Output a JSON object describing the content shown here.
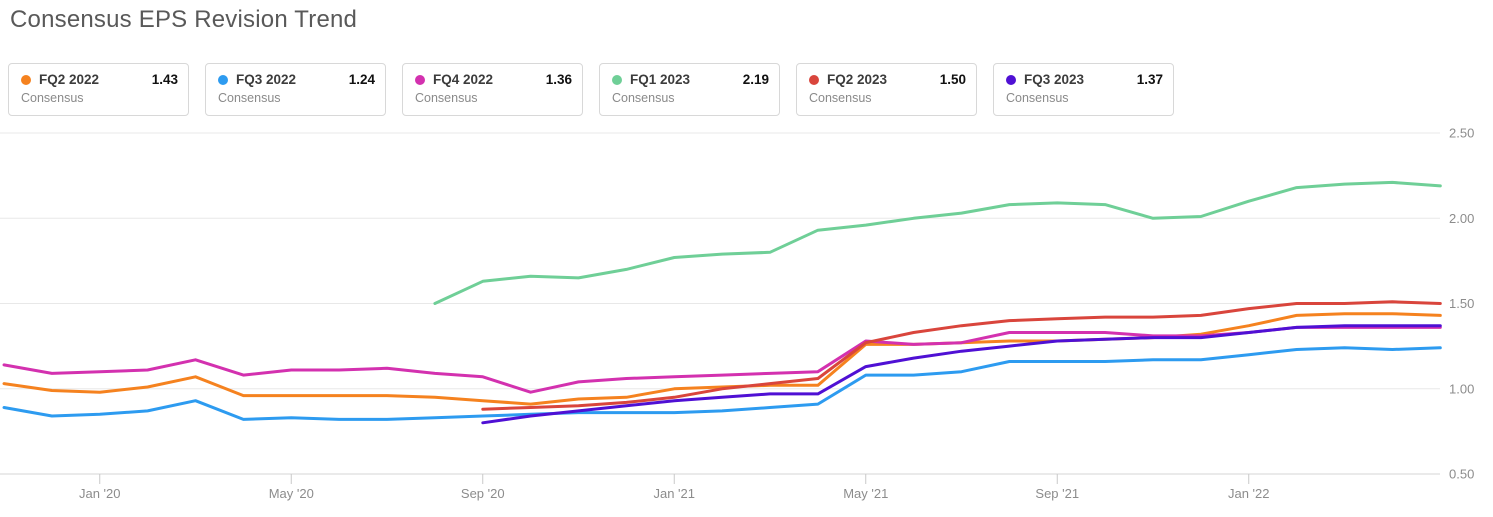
{
  "title": "Consensus EPS Revision Trend",
  "legend": {
    "sub_label": "Consensus",
    "items": [
      {
        "label": "FQ2 2022",
        "value": "1.43",
        "color": "#f5821f"
      },
      {
        "label": "FQ3 2022",
        "value": "1.24",
        "color": "#2d9bf0"
      },
      {
        "label": "FQ4 2022",
        "value": "1.36",
        "color": "#d331af"
      },
      {
        "label": "FQ1 2023",
        "value": "2.19",
        "color": "#6fcf97"
      },
      {
        "label": "FQ2 2023",
        "value": "1.50",
        "color": "#d9453c"
      },
      {
        "label": "FQ3 2023",
        "value": "1.37",
        "color": "#4f10d4"
      }
    ]
  },
  "colors": {
    "title_text": "#595959",
    "grid_line": "#e8e8e8",
    "axis_line": "#d4d4d4",
    "tick_mark": "#c9c9c9",
    "axis_text": "#8c8c8c",
    "background": "#ffffff"
  },
  "chart_data": {
    "type": "line",
    "title": "Consensus EPS Revision Trend",
    "xlabel": "",
    "ylabel": "",
    "ylim": [
      0.5,
      2.5
    ],
    "grid": true,
    "legend_position": "top",
    "x_categories": [
      "Nov '19",
      "Dec '19",
      "Jan '20",
      "Feb '20",
      "Mar '20",
      "Apr '20",
      "May '20",
      "Jun '20",
      "Jul '20",
      "Aug '20",
      "Sep '20",
      "Oct '20",
      "Nov '20",
      "Dec '20",
      "Jan '21",
      "Feb '21",
      "Mar '21",
      "Apr '21",
      "May '21",
      "Jun '21",
      "Jul '21",
      "Aug '21",
      "Sep '21",
      "Oct '21",
      "Nov '21",
      "Dec '21",
      "Jan '22",
      "Feb '22",
      "Mar '22",
      "Apr '22",
      "May '22"
    ],
    "x_tick_labels": [
      "Jan '20",
      "May '20",
      "Sep '20",
      "Jan '21",
      "May '21",
      "Sep '21",
      "Jan '22"
    ],
    "x_tick_indices": [
      2,
      6,
      10,
      14,
      18,
      22,
      26
    ],
    "y_ticks": [
      {
        "label": "2.50",
        "value": 2.5
      },
      {
        "label": "2.00",
        "value": 2.0
      },
      {
        "label": "1.50",
        "value": 1.5
      },
      {
        "label": "1.00",
        "value": 1.0
      },
      {
        "label": "0.50",
        "value": 0.5
      }
    ],
    "series": [
      {
        "name": "FQ2 2022 Consensus",
        "color": "#f5821f",
        "start_index": 0,
        "end_value": 1.43,
        "values": [
          1.03,
          0.99,
          0.98,
          1.01,
          1.07,
          0.96,
          0.96,
          0.96,
          0.96,
          0.95,
          0.93,
          0.91,
          0.94,
          0.95,
          1.0,
          1.01,
          1.02,
          1.02,
          1.26,
          1.26,
          1.27,
          1.28,
          1.28,
          1.29,
          1.3,
          1.32,
          1.37,
          1.43,
          1.44,
          1.44,
          1.43
        ]
      },
      {
        "name": "FQ3 2022 Consensus",
        "color": "#2d9bf0",
        "start_index": 0,
        "end_value": 1.24,
        "values": [
          0.89,
          0.84,
          0.85,
          0.87,
          0.93,
          0.82,
          0.83,
          0.82,
          0.82,
          0.83,
          0.84,
          0.85,
          0.86,
          0.86,
          0.86,
          0.87,
          0.89,
          0.91,
          1.08,
          1.08,
          1.1,
          1.16,
          1.16,
          1.16,
          1.17,
          1.17,
          1.2,
          1.23,
          1.24,
          1.23,
          1.24
        ]
      },
      {
        "name": "FQ4 2022 Consensus",
        "color": "#d331af",
        "start_index": 0,
        "end_value": 1.36,
        "values": [
          1.14,
          1.09,
          1.1,
          1.11,
          1.17,
          1.08,
          1.11,
          1.11,
          1.12,
          1.09,
          1.07,
          0.98,
          1.04,
          1.06,
          1.07,
          1.08,
          1.09,
          1.1,
          1.28,
          1.26,
          1.27,
          1.33,
          1.33,
          1.33,
          1.31,
          1.31,
          1.33,
          1.36,
          1.36,
          1.36,
          1.36
        ]
      },
      {
        "name": "FQ1 2023 Consensus",
        "color": "#6fcf97",
        "start_index": 9,
        "end_value": 2.19,
        "values": [
          1.5,
          1.63,
          1.66,
          1.65,
          1.7,
          1.77,
          1.79,
          1.8,
          1.93,
          1.96,
          2.0,
          2.03,
          2.08,
          2.09,
          2.08,
          2.0,
          2.01,
          2.1,
          2.18,
          2.2,
          2.21,
          2.19
        ]
      },
      {
        "name": "FQ2 2023 Consensus",
        "color": "#d9453c",
        "start_index": 10,
        "end_value": 1.5,
        "values": [
          0.88,
          0.89,
          0.9,
          0.92,
          0.95,
          1.0,
          1.03,
          1.06,
          1.27,
          1.33,
          1.37,
          1.4,
          1.41,
          1.42,
          1.42,
          1.43,
          1.47,
          1.5,
          1.5,
          1.51,
          1.5
        ]
      },
      {
        "name": "FQ3 2023 Consensus",
        "color": "#4f10d4",
        "start_index": 10,
        "end_value": 1.37,
        "values": [
          0.8,
          0.84,
          0.87,
          0.9,
          0.93,
          0.95,
          0.97,
          0.97,
          1.13,
          1.18,
          1.22,
          1.25,
          1.28,
          1.29,
          1.3,
          1.3,
          1.33,
          1.36,
          1.37,
          1.37,
          1.37
        ]
      }
    ]
  }
}
